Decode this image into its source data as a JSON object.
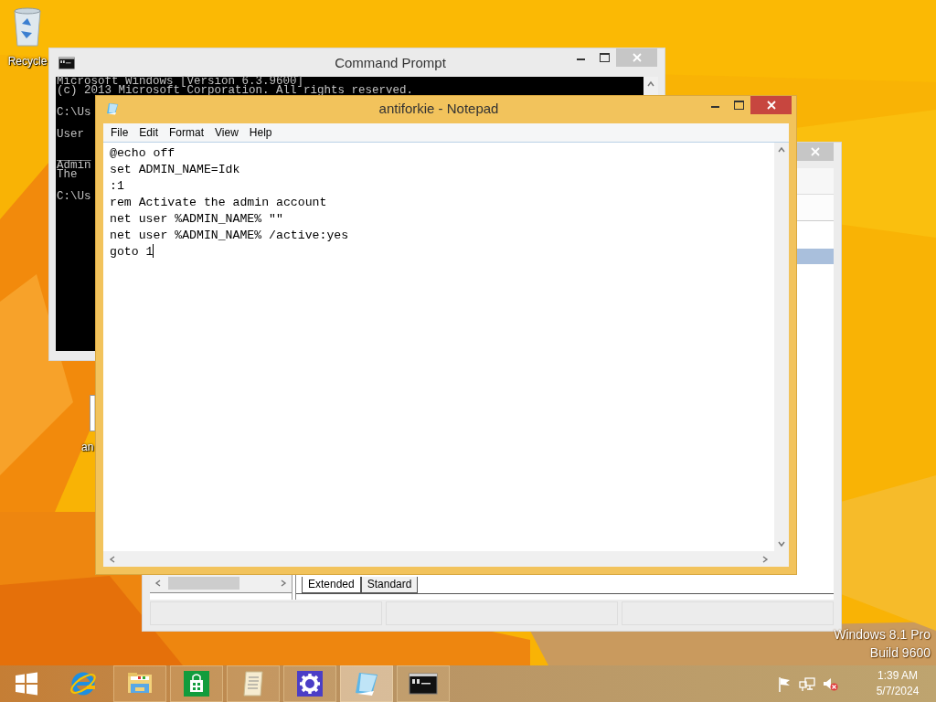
{
  "desktop": {
    "icons": [
      {
        "kind": "recycle-bin",
        "label": "Recycle"
      },
      {
        "kind": "file",
        "label": "an"
      }
    ],
    "watermark": [
      "Windows 8.1 Pro",
      "Build 9600"
    ]
  },
  "command_prompt": {
    "title": "Command Prompt",
    "output": [
      [
        "Microsoft Windows [Version 6.3.9600]",
        "(c) 2013 Microsoft Corporation. All rights reserved."
      ],
      [
        "C:\\Us"
      ],
      [
        "User"
      ],
      [
        "_____",
        "Admin",
        "The"
      ],
      [
        "C:\\Us"
      ]
    ]
  },
  "background_window": {
    "tabs": [
      {
        "label": "Extended",
        "selected": true
      },
      {
        "label": "Standard",
        "selected": false
      }
    ]
  },
  "notepad": {
    "title": "antiforkie - Notepad",
    "menu": [
      "File",
      "Edit",
      "Format",
      "View",
      "Help"
    ],
    "lines": [
      "@echo off",
      "set ADMIN_NAME=Idk",
      ":1",
      "rem Activate the admin account",
      "net user %ADMIN_NAME% \"\"",
      "net user %ADMIN_NAME% /active:yes",
      "goto 1"
    ]
  },
  "taskbar": {
    "buttons": [
      {
        "kind": "start",
        "running": false,
        "selected": false
      },
      {
        "kind": "browser",
        "running": false,
        "selected": false
      },
      {
        "kind": "folder",
        "running": true,
        "selected": false
      },
      {
        "kind": "store",
        "running": true,
        "selected": false
      },
      {
        "kind": "scroll",
        "running": true,
        "selected": false
      },
      {
        "kind": "settings",
        "running": true,
        "selected": false
      },
      {
        "kind": "notepad",
        "running": true,
        "selected": true
      },
      {
        "kind": "console",
        "running": true,
        "selected": false
      }
    ],
    "tray_icons": [
      {
        "kind": "flag"
      },
      {
        "kind": "network"
      },
      {
        "kind": "speaker-muted"
      }
    ],
    "clock": {
      "time": "1:39 AM",
      "date": "5/7/2024"
    }
  }
}
